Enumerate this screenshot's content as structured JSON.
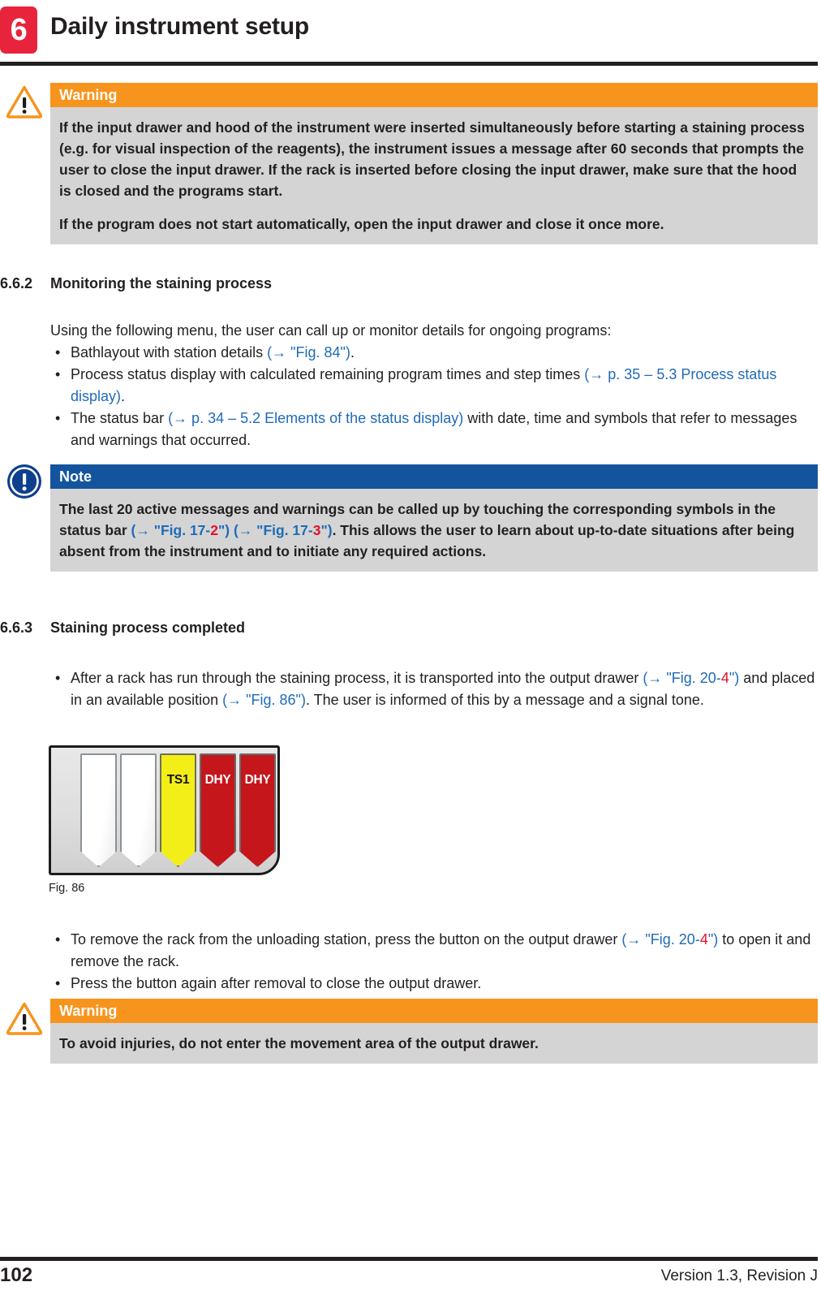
{
  "header": {
    "chapter_number": "6",
    "chapter_title": "Daily instrument setup"
  },
  "warning_top": {
    "icon": "warning-triangle-icon",
    "label": "Warning",
    "paragraph_1": "If the input drawer and hood of the instrument were inserted simultaneously before starting a staining process (e.g. for visual inspection of the reagents), the instrument issues a message after 60 seconds that prompts the user to close the input drawer. If the rack is inserted before closing the input drawer, make sure that the hood is closed and the programs start.",
    "paragraph_2": "If the program does not start automatically, open the input drawer and close it once more."
  },
  "section_662": {
    "number": "6.6.2",
    "title": "Monitoring the staining process",
    "intro": "Using the following menu, the user can call up or monitor details for ongoing programs:",
    "bullet_1_pre": "Bathlayout with station details ",
    "bullet_1_xref": "(→ \"Fig. 84\")",
    "bullet_1_post": ".",
    "bullet_2_pre": "Process status display with calculated remaining program times and step times ",
    "bullet_2_xref": "(→ p. 35 – 5.3 Process status display)",
    "bullet_2_post": ".",
    "bullet_3_pre": "The status bar ",
    "bullet_3_xref": "(→ p. 34 – 5.2 Elements of the status display)",
    "bullet_3_post": " with date, time and symbols that refer to messages and warnings that occurred."
  },
  "note_box": {
    "icon": "note-info-icon",
    "label": "Note",
    "text_part_1": "The last 20 active messages and warnings can be called up by touching the corresponding symbols in the status bar ",
    "xref_1_open": "(→ \"Fig. 17-",
    "xref_1_num": "2",
    "xref_1_close": "\")",
    "xref_2_open": " (→ \"Fig. 17-",
    "xref_2_num": "3",
    "xref_2_close": "\")",
    "text_part_2": ". This allows the user to learn about up-to-date situations after being absent from the instrument and to initiate any required actions."
  },
  "section_663": {
    "number": "6.6.3",
    "title": "Staining process completed",
    "bullet_1_pre": "After a rack has run through the staining process, it is transported into the output drawer ",
    "bullet_1_xref_open": "(→ \"Fig. 20-",
    "bullet_1_xref_num": "4",
    "bullet_1_xref_close": "\")",
    "bullet_1_mid": " and placed in an available position ",
    "bullet_1_xref2": "(→ \"Fig. 86\")",
    "bullet_1_post": ". The user is informed of this by a message and a signal tone.",
    "bullet_2_pre": "To remove the rack from the unloading station, press the button on the output drawer ",
    "bullet_2_xref_open": "(→ \"Fig. 20-",
    "bullet_2_xref_num": "4",
    "bullet_2_xref_close": "\")",
    "bullet_2_post": " to open it and remove the rack.",
    "bullet_3": "Press the button again after removal to close the output drawer."
  },
  "figure": {
    "caption": "Fig. 86",
    "slots": [
      {
        "label": "",
        "state": "empty"
      },
      {
        "label": "",
        "state": "empty"
      },
      {
        "label": "TS1",
        "state": "ts1"
      },
      {
        "label": "DHY",
        "state": "dhy"
      },
      {
        "label": "DHY",
        "state": "dhy"
      }
    ]
  },
  "warning_bottom": {
    "icon": "warning-triangle-icon",
    "label": "Warning",
    "text": "To avoid injuries, do not enter the movement area of the output drawer."
  },
  "footer": {
    "page_number": "102",
    "version": "Version 1.3, Revision J"
  },
  "colors": {
    "chapter_badge": "#e8243c",
    "warning_header": "#f7941d",
    "note_header": "#14549e",
    "callout_body": "#d4d4d4",
    "xref_link": "#1f6bb8",
    "xref_number": "#e8102a",
    "slot_ts1": "#f4ee18",
    "slot_dhy": "#c5161c",
    "rule": "#231f20"
  }
}
